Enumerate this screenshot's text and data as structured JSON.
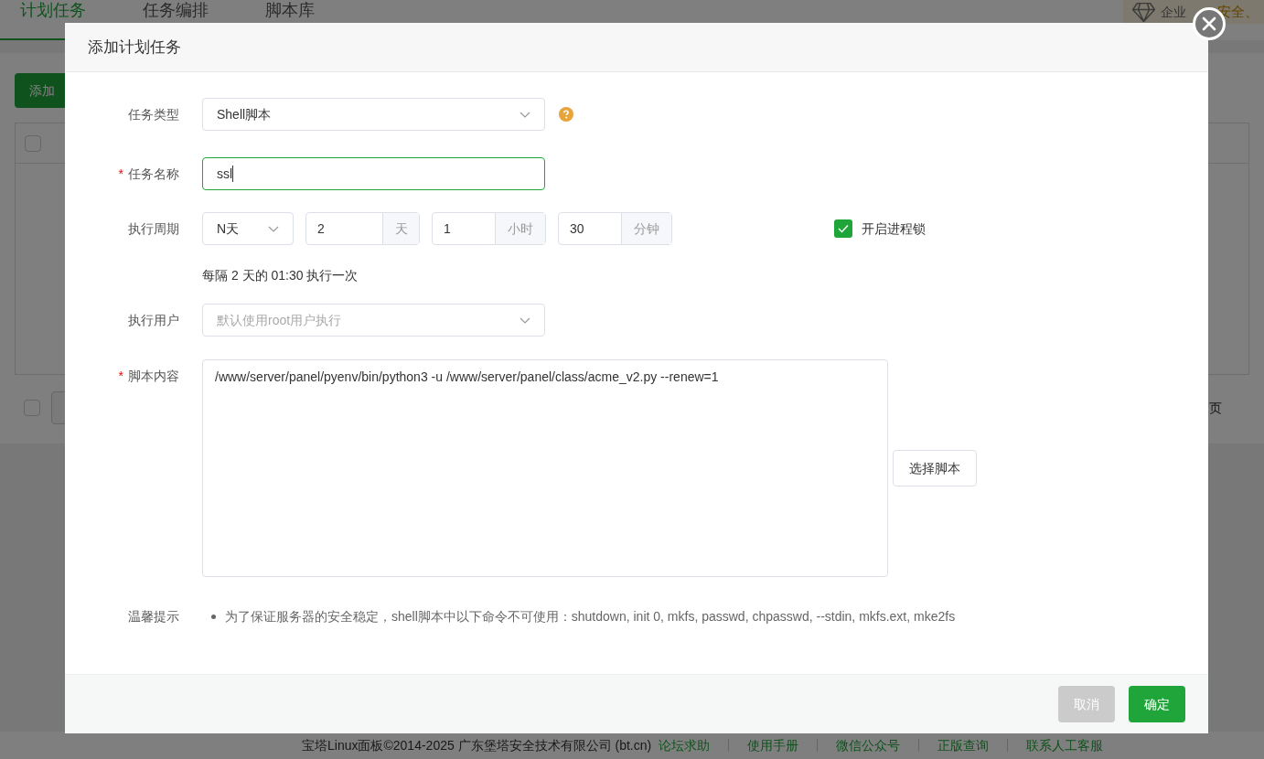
{
  "page": {
    "tabs": [
      {
        "label": "计划任务",
        "selected": true
      },
      {
        "label": "任务编排",
        "selected": false
      },
      {
        "label": "脚本库",
        "selected": false
      }
    ],
    "badge": {
      "label": "企业",
      "slogan": "安全、"
    },
    "add_button": "添加",
    "table": {
      "header_checked": false
    },
    "pagination": {
      "checked": false
    },
    "pagination_text": "页",
    "footer": {
      "copyright": "宝塔Linux面板©2014-2025 广东堡塔安全技术有限公司 (bt.cn)",
      "links": [
        "论坛求助",
        "使用手册",
        "微信公众号",
        "正版查询",
        "联系人工客服"
      ]
    }
  },
  "dialog": {
    "title": "添加计划任务",
    "task_type": {
      "label": "任务类型",
      "value": "Shell脚本"
    },
    "task_name": {
      "mark": "*",
      "label": "任务名称",
      "value": "ssl",
      "focused": true
    },
    "period": {
      "label": "执行周期",
      "unit_select": "N天",
      "inputs": [
        {
          "value": "2",
          "unit": "天"
        },
        {
          "value": "1",
          "unit": "小时"
        },
        {
          "value": "30",
          "unit": "分钟"
        }
      ],
      "summary": "每隔 2 天的 01:30 执行一次"
    },
    "process_lock": {
      "label": "开启进程锁",
      "checked": true
    },
    "user": {
      "label": "执行用户",
      "placeholder": "默认使用root用户执行"
    },
    "script": {
      "mark": "*",
      "label": "脚本内容",
      "value": "/www/server/panel/pyenv/bin/python3 -u /www/server/panel/class/acme_v2.py --renew=1",
      "button": "选择脚本"
    },
    "tips": {
      "label": "温馨提示",
      "items": [
        "为了保证服务器的安全稳定，shell脚本中以下命令不可使用：shutdown, init 0, mkfs, passwd, chpasswd, --stdin, mkfs.ext, mke2fs"
      ]
    },
    "buttons": [
      {
        "label": "取消",
        "kind": "cancel"
      },
      {
        "label": "确定",
        "kind": "primary"
      }
    ]
  }
}
